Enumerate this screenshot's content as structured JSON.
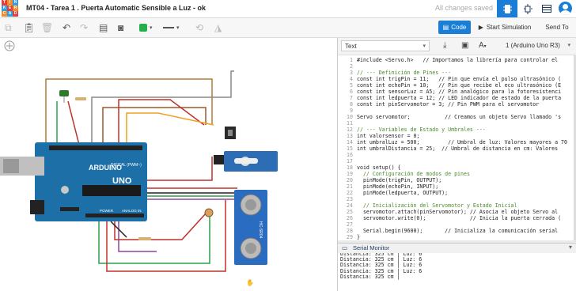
{
  "app": {
    "logo_letters": [
      "TIN",
      "KER",
      "CAD"
    ],
    "title": "MT04 - Tarea 1 . Puerta Automatic Sensible a Luz - ok",
    "status": "All changes saved"
  },
  "topbar": {
    "icons": [
      "circuit-view-icon",
      "schematic-view-icon",
      "component-list-icon",
      "user-avatar"
    ]
  },
  "toolbar": {
    "code_label": "Code",
    "simulation_label": "Start Simulation",
    "send_label": "Send To"
  },
  "code_panel": {
    "mode": "Text",
    "device": "1 (Arduino Uno R3)",
    "lines": [
      "#include <Servo.h>   // Importamos la librería para controlar el",
      "",
      "// --- Definición de Pines ---",
      "const int trigPin = 11;   // Pin que envía el pulso ultrasónico (",
      "const int echoPin = 10;   // Pin que recibe el eco ultrasónico (E",
      "const int sensorLuz = A5; // Pin analógico para la fotoresistenci",
      "const int ledpuerta = 12; // LED indicador de estado de la puerta",
      "const int pinServomotor = 3; // Pin PWM para el servomotor",
      "",
      "Servo servomotor;           // Creamos un objeto Servo llamado 's",
      "",
      "// --- Variables de Estado y Umbrales ---",
      "int valorsensor = 0;",
      "int umbralLuz = 500;         // Umbral de luz: Valores mayores a 70",
      "int umbralDistancia = 25;  // Umbral de distancia en cm: Valores",
      "",
      "",
      "void setup() {",
      "  // Configuración de modos de pines",
      "  pinMode(trigPin, OUTPUT);",
      "  pinMode(echoPin, INPUT);",
      "  pinMode(ledpuerta, OUTPUT);",
      "",
      "  // Inicialización del Servomotor y Estado Inicial",
      "  servomotor.attach(pinServomotor); // Asocia el objeto Servo al",
      "  servomotor.write(0);              // Inicia la puerta cerrada (",
      "",
      "  Serial.begin(9600);       // Inicializa la comunicación serial",
      "}"
    ]
  },
  "serial_monitor": {
    "title": "Serial Monitor",
    "lines": [
      "Distancia: 325 cm | Luz: 6",
      "Distancia: 325 cm | Luz: 6",
      "Distancia: 325 cm | Luz: 6",
      "Distancia: 325 cm | Luz: 6",
      "Distancia: 325 cm | Luz: 6",
      "Distancia: 325 cm | "
    ]
  },
  "circuit": {
    "board_brand": "ARDUINO",
    "board_model": "UNO",
    "board_label": "DIGITAL (PWM~)",
    "board_power": "POWER",
    "board_analog": "ANALOG IN",
    "sensor_label": "HC-SR04"
  },
  "colors": {
    "accent": "#1a7ed6",
    "board": "#1c6fa7",
    "servo": "#2d6db5",
    "sensor": "#2a6cc0"
  }
}
